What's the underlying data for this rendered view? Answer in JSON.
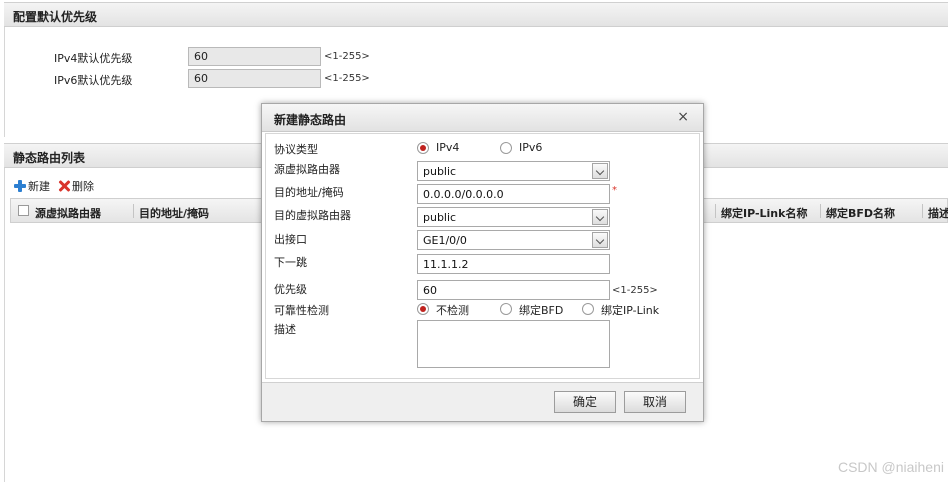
{
  "default_priority": {
    "title": "配置默认优先级",
    "ipv4_label": "IPv4默认优先级",
    "ipv4_value": "60",
    "ipv4_range": "<1-255>",
    "ipv6_label": "IPv6默认优先级",
    "ipv6_value": "60",
    "ipv6_range": "<1-255>"
  },
  "route_list": {
    "title": "静态路由列表",
    "add_label": "新建",
    "delete_label": "删除",
    "columns": [
      "源虚拟路由器",
      "目的地址/掩码",
      "绑定IP-Link名称",
      "绑定BFD名称",
      "描述"
    ]
  },
  "dialog": {
    "title": "新建静态路由",
    "close": "×",
    "protocol_label": "协议类型",
    "protocol_options": [
      "IPv4",
      "IPv6"
    ],
    "protocol_selected": "IPv4",
    "src_vr_label": "源虚拟路由器",
    "src_vr_value": "public",
    "dest_label": "目的地址/掩码",
    "dest_value": "0.0.0.0/0.0.0.0",
    "required_mark": "*",
    "dest_vr_label": "目的虚拟路由器",
    "dest_vr_value": "public",
    "egress_label": "出接口",
    "egress_value": "GE1/0/0",
    "nexthop_label": "下一跳",
    "nexthop_value": "11.1.1.2",
    "priority_label": "优先级",
    "priority_value": "60",
    "priority_range": "<1-255>",
    "reachability_label": "可靠性检测",
    "reachability_options": [
      "不检测",
      "绑定BFD",
      "绑定IP-Link"
    ],
    "reachability_selected": "不检测",
    "desc_label": "描述",
    "desc_value": "",
    "ok_label": "确定",
    "cancel_label": "取消"
  },
  "watermark": "CSDN @niaiheni",
  "colors": {
    "radio_selected": "#c0231f",
    "required_mark": "#d9342b",
    "add_icon": "#2c7fd1",
    "delete_icon": "#d9342b"
  }
}
